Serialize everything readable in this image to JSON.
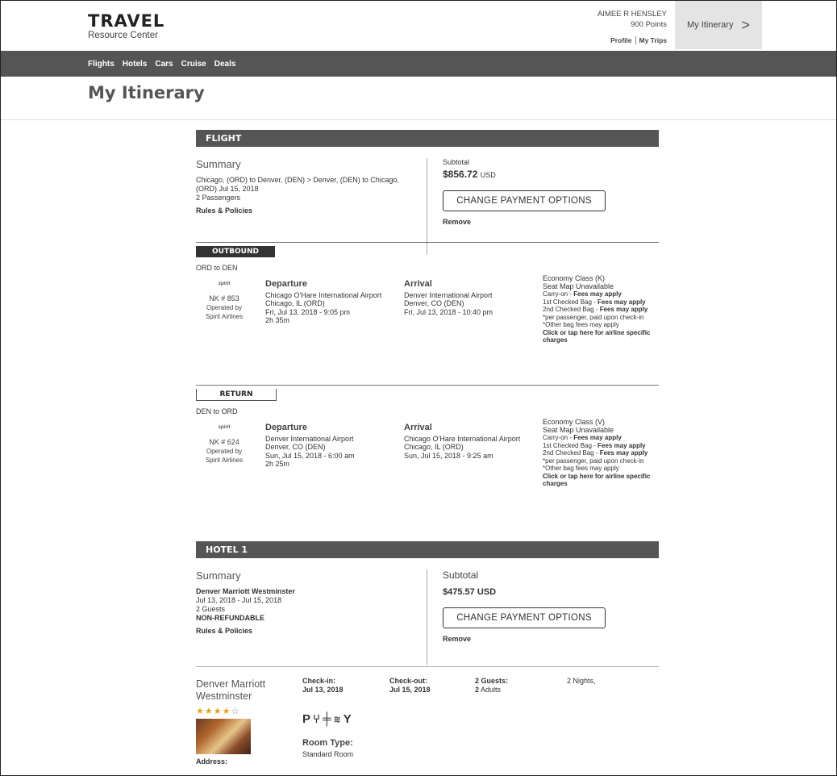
{
  "brand": {
    "title": "TRAVEL",
    "subtitle": "Resource Center"
  },
  "user": {
    "name": "AIMEE R HENSLEY",
    "points": "900 Points",
    "links": [
      "Profile",
      "My Trips"
    ]
  },
  "itinerary_button": {
    "label": "My Itinerary",
    "chevron": ">"
  },
  "nav": [
    "Flights",
    "Hotels",
    "Cars",
    "Cruise",
    "Deals"
  ],
  "page_title": "My Itinerary",
  "flight": {
    "bar": "FLIGHT",
    "summary_heading": "Summary",
    "route": "Chicago, (ORD) to Denver, (DEN)  >  Denver, (DEN) to Chicago, (ORD) Jul 15, 2018",
    "passengers": "2 Passengers",
    "rules": "Rules & Policies",
    "subtotal_label": "Subtotal",
    "subtotal_amount": "$856.72",
    "subtotal_currency": "USD",
    "change_payment": "CHANGE PAYMENT OPTIONS",
    "remove": "Remove"
  },
  "legs": [
    {
      "tab": "OUTBOUND",
      "route": "ORD to DEN",
      "airline_logo": "spirit",
      "flight_no": "NK # 853",
      "operated_by": "Operated by",
      "operator": "Spirit Airlines",
      "dep_heading": "Departure",
      "dep_airport": "Chicago O'Hare International Airport",
      "dep_city": "Chicago, IL (ORD)",
      "dep_time": "Fri, Jul 13, 2018 - 9:05 pm",
      "duration": "2h 35m",
      "arr_heading": "Arrival",
      "arr_airport": "Denver International Airport",
      "arr_city": "Denver, CO (DEN)",
      "arr_time": "Fri, Jul 13, 2018 - 10:40 pm",
      "class": "Economy Class (K)",
      "seat": "Seat Map Unavailable",
      "carry_on": "Carry-on - ",
      "first_bag": "1st Checked Bag - ",
      "second_bag": "2nd Checked Bag - ",
      "fees": "Fees may apply",
      "per_passenger": "*per passenger, paid upon check-in",
      "other_fees": "*Other bag fees may apply",
      "airline_link": "Click or tap here for airline specific charges"
    },
    {
      "tab": "RETURN",
      "route": "DEN to ORD",
      "airline_logo": "spirit",
      "flight_no": "NK # 624",
      "operated_by": "Operated by",
      "operator": "Spirit Airlines",
      "dep_heading": "Departure",
      "dep_airport": "Denver International Airport",
      "dep_city": "Denver, CO (DEN)",
      "dep_time": "Sun, Jul 15, 2018 - 6:00 am",
      "duration": "2h 25m",
      "arr_heading": "Arrival",
      "arr_airport": "Chicago O'Hare International Airport",
      "arr_city": "Chicago, IL (ORD)",
      "arr_time": "Sun, Jul 15, 2018 - 9:25 am",
      "class": "Economy Class (V)",
      "seat": "Seat Map Unavailable",
      "carry_on": "Carry-on - ",
      "first_bag": "1st Checked Bag - ",
      "second_bag": "2nd Checked Bag - ",
      "fees": "Fees may apply",
      "per_passenger": "*per passenger, paid upon check-in",
      "other_fees": "*Other bag fees may apply",
      "airline_link": "Click or tap here for airline specific charges"
    }
  ],
  "hotel": {
    "bar": "HOTEL 1",
    "summary_heading": "Summary",
    "name": "Denver Marriott Westminster",
    "dates": "Jul 13, 2018 - Jul 15, 2018",
    "guests": "2 Guests",
    "refund": "NON-REFUNDABLE",
    "rules": "Rules & Policies",
    "subtotal_label": "Subtotal",
    "subtotal_amount": "$475.57 USD",
    "change_payment": "CHANGE PAYMENT OPTIONS",
    "remove": "Remove",
    "stay_name": "Denver Marriott Westminster",
    "stars_filled": "★★★★",
    "stars_empty": "☆",
    "rating": 4,
    "checkin_label": "Check-in:",
    "checkin_date": "Jul 13, 2018",
    "checkout_label": "Check-out:",
    "checkout_date": "Jul 15, 2018",
    "guests_label": "2 Guests:",
    "guests_count": "2",
    "guests_unit": " Adults",
    "nights": "2 Nights,",
    "amenity_icons": [
      "parking-icon",
      "restaurant-icon",
      "fitness-icon",
      "pool-icon",
      "bar-icon"
    ],
    "room_type_label": "Room Type:",
    "room_type": "Standard Room",
    "address_label": "Address:"
  }
}
